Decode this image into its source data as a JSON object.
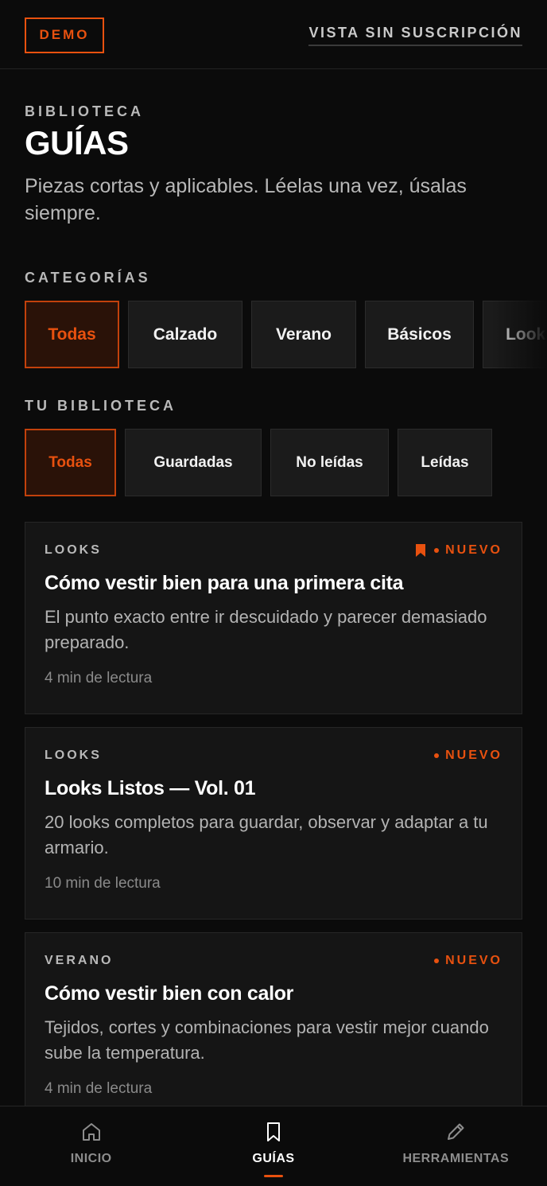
{
  "header": {
    "demo_badge": "DEMO",
    "subscription_link": "VISTA SIN SUSCRIPCIÓN"
  },
  "intro": {
    "eyebrow": "BIBLIOTECA",
    "title": "GUÍAS",
    "subtitle": "Piezas cortas y aplicables. Léelas una vez, úsalas siempre."
  },
  "categories": {
    "label": "CATEGORÍAS",
    "selected": "Todas",
    "items": [
      "Todas",
      "Calzado",
      "Verano",
      "Básicos",
      "Looks"
    ]
  },
  "library": {
    "label": "TU BIBLIOTECA",
    "selected": "Todas",
    "items": [
      "Todas",
      "Guardadas",
      "No leídas",
      "Leídas"
    ]
  },
  "guides": [
    {
      "category": "LOOKS",
      "saved": true,
      "new_label": "NUEVO",
      "title": "Cómo vestir bien para una primera cita",
      "description": "El punto exacto entre ir descuidado y parecer demasiado preparado.",
      "read_time": "4 min de lectura"
    },
    {
      "category": "LOOKS",
      "saved": false,
      "new_label": "NUEVO",
      "title": "Looks Listos — Vol. 01",
      "description": "20 looks completos para guardar, observar y adaptar a tu armario.",
      "read_time": "10 min de lectura"
    },
    {
      "category": "VERANO",
      "saved": false,
      "new_label": "NUEVO",
      "title": "Cómo vestir bien con calor",
      "description": "Tejidos, cortes y combinaciones para vestir mejor cuando sube la temperatura.",
      "read_time": "4 min de lectura"
    }
  ],
  "bottom_nav": {
    "active": "GUÍAS",
    "items": [
      {
        "label": "INICIO",
        "icon": "home-icon"
      },
      {
        "label": "GUÍAS",
        "icon": "bookmark-icon"
      },
      {
        "label": "HERRAMIENTAS",
        "icon": "pencil-icon"
      }
    ]
  },
  "colors": {
    "accent": "#e8510f",
    "background": "#0b0b0b",
    "card": "#151515"
  }
}
